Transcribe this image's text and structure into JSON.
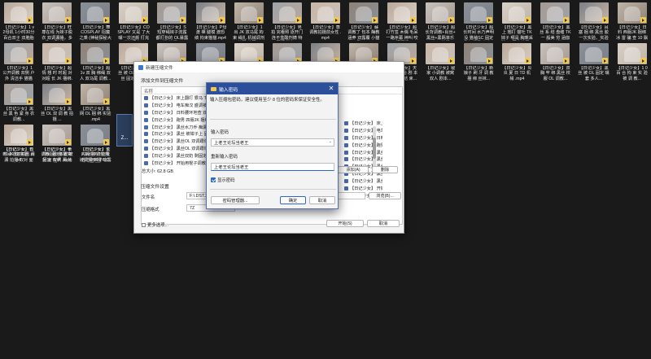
{
  "desktop": {
    "files": [
      {
        "name": "【日记少女】1 v2母机 1小时30分 百合双子 双胞胎OL 百合..."
      },
      {
        "name": "【日记少女】旺 尊在线 为妹子脱 衣 双调漏播，多 场面呀前略..."
      },
      {
        "name": "【日记少女】舞 COSPLAY 招魔 之乘 (神秘探秘大 小 3CM) 撩妹..."
      },
      {
        "name": "【日记少女】COSPLAY 又是 了大嘴一次还颜 打充 满姿调恋..."
      },
      {
        "name": "【日记少女】S 短穿绳妹子流露 都打扮的 OL暴露找 拍摄..."
      },
      {
        "name": "【日记少女】P母 渡 裸 腿模 渡恐绩 拘束猫猫.mp4"
      },
      {
        "name": "【日记少女】1 出 JK 双马尾 拘 束 绳扎 机械调剂 抹强 拍照..."
      },
      {
        "name": "【日记少女】男 拍 完看照 逐开门 连不盒酸剂铸 特 翻打 粉宫..."
      },
      {
        "name": "【日记少女】尊 调教拍摄前女性 .mp4"
      },
      {
        "name": "【日记少女】蘇 调教了 包本 酶教 涵养 双露覆 小猫 剧.mp4"
      },
      {
        "name": "【日记少女】超 打竹签 木偶 毛呆 一路序幕 神叫 咬 双调漏播..."
      },
      {
        "name": "【日记少女】超 长背调教+肖丝+ 黑丝+黑羁单乐 ～ 公开拍播..."
      },
      {
        "name": "【日记少女】超 长时间 水乃声明 没 猫袖SC 固定 后宫 摆露 多次..."
      },
      {
        "name": "【日记少女】黑 上 翘打 猫吐 TK 妹子 哪是 胸乘采 腿2.0 固定放置..."
      },
      {
        "name": "【日记少女】黑 丝 系 结 盘缠 TK 一 般美 穷 涵伽 夹子双首..."
      },
      {
        "name": "【日记少女】耳 塞 捆 绑 黑丝 胶 一次实验、实验 丝袜好 后..."
      },
      {
        "name": "【日记少女】日 料 西服JK 捆绑 冰 雷 骗 查 10 飘流..."
      },
      {
        "name": "【日记少女】1 公开调教 双侧 户外 清洁手 猫猫 暗合..."
      },
      {
        "name": "【日记少女】超 情 翘 时 时超 对 对超 长 JK 捆绑.mp4"
      },
      {
        "name": "【日记少女】超 1v 双 胸 绑绳 双人 双马尾 调教..."
      },
      {
        "name": "【日记少女】黑 丝 被 OL 绳束 黑丝 固定姿势..."
      },
      {
        "name": "【日记少女】挺 大 JK 猫爪 挂 钩 小猫 .mp4"
      },
      {
        "name": "【日记少女】黑 发 大 小 双 马尾 挂钩 调教..."
      },
      {
        "name": "【日记少女】两 丝 绑 束 拍照 教育 .mp4"
      },
      {
        "name": "【日记少女】双 OL 盘根 绳艺 拍摄 小猫..."
      },
      {
        "name": "【日记少女】双 女生 冬天 上 拍照 双人 小可爱..."
      },
      {
        "name": "【日记少女】双 丝 袜子 翻翻 双人 翘首 多人 拍摄..."
      },
      {
        "name": "【日记少女】天 真 了 被 给 剧 本 拍 摄 不 结 束..."
      },
      {
        "name": "【日记少女】寝 家 小调教 被窝 双人 剧本..."
      },
      {
        "name": "【日记少女】新 娘子 刷 牙 调 教 捆 绑 丝袜..."
      },
      {
        "name": "【日记少女】炎 炎 夏 日 TD 机 械 .mp4"
      },
      {
        "name": "【日记少女】双 胸 牢 绑 黑丝 校服 OL 调教..."
      },
      {
        "name": "【日记少女】黑 丝 被 OL 固定 嘴 套 多人..."
      },
      {
        "name": "【日记少女】1 0 百 合 拘 束 实 验 被 调 教..."
      },
      {
        "name": "【日记少女】黑 丝 黑 色 紧 身 衣 调教..."
      },
      {
        "name": "【日记少女】黑 丝 OL 双 调 教 拍 摄 ..."
      },
      {
        "name": "【日记少女】黑 网 OL 捆 绑 实验 .mp4"
      },
      {
        "name": "【日记少女】日 料 JK 双 实验 .mp4"
      },
      {
        "name": "【日记少女】长 时间 捆 绑 被窝 固定 有声 .mp4"
      },
      {
        "name": "【日记少女】长 时间 绑 德丽丽 被调漏 B 漫 哈露 漏播..."
      },
      {
        "name": "【日记少女】长 时间 德丽丽园 调漏 拍摄 双对 面 多人..."
      },
      {
        "name": "【日记少女】半 调教 固定放置 被 对 面 双调 漏 拍播..."
      },
      {
        "name": "【日记少女】主 人的任务!! 让我 自己用棒子GC 自 拍 还是双..."
      }
    ],
    "selected_label": "Z..."
  },
  "archive_dialog": {
    "title": "新建压缩文件",
    "add_section": "添加文件到压缩文件",
    "list_header": "名称",
    "items": [
      "【日记少女】 床上翻打 狠马 TK 拘束 旁",
      "【日记少女】 电车痴汉 盛调被 被...",
      "【日记少女】 日料腰环地查 双调...",
      "【日记少女】 跑男 四服JK 捆绑...",
      "【日记少女】 黑丝水刀乔 痴漏...",
      "【日记少女】 黑丝 被钳子上 固...",
      "【日记少女】 黑丝OL 双调跟课...",
      "【日记少女】 黑丝OL 双调跟课...",
      "【日记少女】 黑丝双奶 剩固定...",
      "【日记少女】 开始用棍子调教国..."
    ],
    "items_right": [
      "【日记少女】 床上翻...",
      "【日记少女】 电车痴...",
      "【日记少女】 日料...",
      "【日记少女】 跑男...",
      "【日记少女】 黑丝...",
      "【日记少女】 黑丝...",
      "【日记少女】 黑丝O...",
      "【日记少女】 黑丝O...",
      "【日记少女】 黑丝双...",
      "【日记少女】 开始用...",
      "【日记少女】 开始用..."
    ],
    "total_size": "总大小: 62.8 GB",
    "add_button": "添加(A)",
    "delete_button": "删除",
    "settings_section": "压缩文件设置",
    "filename_label": "文件名",
    "filename_value": "F:\\.DST.2...",
    "browse_button": "浏览(B)...",
    "format_label": "压缩格式",
    "format_value": "7Z",
    "more_options": "更多选项...",
    "start_button": "开始(S)",
    "cancel_button": "取消"
  },
  "password_dialog": {
    "title": "输入密码",
    "hint": "输入压缩包密码，建议使用至少 8 位的密码来保证安全性。",
    "enter_label": "输入密码",
    "enter_value": "上老王论坛当老王",
    "reenter_label": "重新输入密码",
    "reenter_value": "上老王论坛当老王",
    "show_password": "显示密码",
    "manager_button": "密码管理器...",
    "ok_button": "确定",
    "cancel_button": "取消"
  }
}
